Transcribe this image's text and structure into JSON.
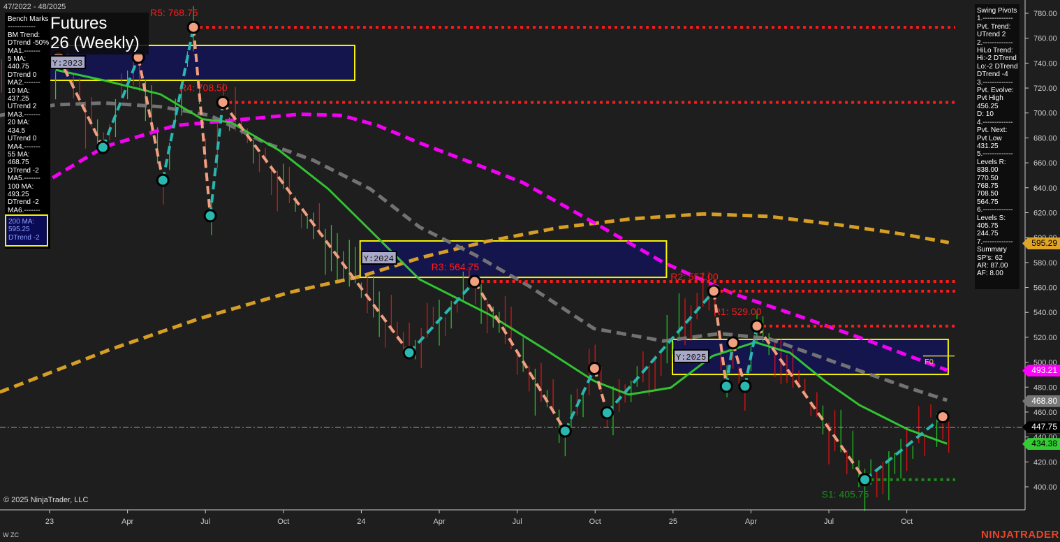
{
  "header": {
    "date_range": "47/2022 - 48/2025",
    "title_line1": "Futures",
    "title_line2": "26 (Weekly)"
  },
  "benchmarks": {
    "lines": [
      "Bench Marks",
      "------------",
      "BM Trend:",
      "DTrend -50%",
      "MA1.-------",
      "5 MA:",
      "440.75",
      "DTrend 0",
      "MA2.-------",
      "10 MA:",
      "437.25",
      "UTrend 2",
      "MA3.-------",
      "20 MA:",
      "434.5",
      "UTrend 0",
      "MA4.-------",
      "55 MA:",
      "468.75",
      "DTrend -2",
      "MA5.-------",
      "100 MA:",
      "493.25",
      "DTrend -2",
      "MA6.-------"
    ],
    "highlight": [
      "200 MA:",
      "595.25",
      "DTrend -2"
    ]
  },
  "swing_pivots": {
    "lines": [
      "Swing Pivots",
      "1.-------------",
      "Pvt. Trend:",
      "UTrend 2",
      "2.-------------",
      "HiLo Trend:",
      "Hi:-2 DTrend",
      "Lo:-2 DTrend",
      "DTrend -4",
      "3.-------------",
      "Pvt. Evolve:",
      "Pvt High",
      "456.25",
      "D: 10",
      "4.-------------",
      "Pvt. Next:",
      "Pvt Low",
      "431.25",
      "5.-------------",
      "Levels R:",
      "838.00",
      "770.50",
      "768.75",
      "708.50",
      "564.75",
      "6.-------------",
      "Levels S:",
      "405.75",
      "244.75",
      "7.-------------",
      "Summary",
      "SP's: 62",
      "AR: 87.00",
      "AF: 8.00"
    ]
  },
  "footer": {
    "copyright": "© 2025 NinjaTrader, LLC",
    "symbol": "W ZC",
    "brand": "NINJATRADER"
  },
  "price_tags": [
    {
      "value": "595.29",
      "price": 595.29,
      "bg": "#e0a526",
      "fg": "#000"
    },
    {
      "value": "493.21",
      "price": 493.21,
      "bg": "#ff00ff",
      "fg": "#fff"
    },
    {
      "value": "468.80",
      "price": 468.8,
      "bg": "#777777",
      "fg": "#fff"
    },
    {
      "value": "447.75",
      "price": 447.75,
      "bg": "#000000",
      "fg": "#fff"
    },
    {
      "value": "434.38",
      "price": 434.38,
      "bg": "#33cc33",
      "fg": "#000"
    }
  ],
  "chart_data": {
    "type": "line",
    "title": "Futures 26 (Weekly)",
    "x_unit": "weeks since first week of 2023",
    "xlim": [
      -8.3,
      162
    ],
    "ylim": [
      390,
      790
    ],
    "y_ticks": [
      400,
      420,
      440,
      460,
      480,
      500,
      520,
      540,
      560,
      580,
      600,
      620,
      640,
      660,
      680,
      700,
      720,
      740,
      760,
      780
    ],
    "x_ticks": [
      {
        "label": "23",
        "w": 0
      },
      {
        "label": "Apr",
        "w": 13
      },
      {
        "label": "Jul",
        "w": 26
      },
      {
        "label": "Oct",
        "w": 39
      },
      {
        "label": "24",
        "w": 52
      },
      {
        "label": "Apr",
        "w": 65
      },
      {
        "label": "Jul",
        "w": 78
      },
      {
        "label": "Oct",
        "w": 91
      },
      {
        "label": "25",
        "w": 104
      },
      {
        "label": "Apr",
        "w": 117
      },
      {
        "label": "Jul",
        "w": 130
      },
      {
        "label": "Oct",
        "w": 143
      }
    ],
    "current_price": 447.75,
    "swing_pivots": [
      {
        "w": 1.5,
        "p": 745,
        "t": "H"
      },
      {
        "w": 8.9,
        "p": 672.4,
        "t": "L"
      },
      {
        "w": 14.8,
        "p": 744.7,
        "t": "H"
      },
      {
        "w": 18.9,
        "p": 646,
        "t": "L"
      },
      {
        "w": 24,
        "p": 768.75,
        "t": "H"
      },
      {
        "w": 26.8,
        "p": 617.5,
        "t": "L"
      },
      {
        "w": 28.9,
        "p": 708.5,
        "t": "H"
      },
      {
        "w": 60,
        "p": 507.6,
        "t": "L"
      },
      {
        "w": 70.9,
        "p": 564.75,
        "t": "H"
      },
      {
        "w": 86,
        "p": 444.8,
        "t": "L"
      },
      {
        "w": 90.9,
        "p": 495,
        "t": "H"
      },
      {
        "w": 93,
        "p": 459.4,
        "t": "L"
      },
      {
        "w": 110.8,
        "p": 557,
        "t": "H"
      },
      {
        "w": 112.9,
        "p": 480.7,
        "t": "L"
      },
      {
        "w": 114,
        "p": 515.5,
        "t": "H"
      },
      {
        "w": 116,
        "p": 480.7,
        "t": "L"
      },
      {
        "w": 118,
        "p": 529,
        "t": "H"
      },
      {
        "w": 136,
        "p": 405.75,
        "t": "L"
      },
      {
        "w": 149,
        "p": 456.25,
        "t": "H"
      }
    ],
    "levels": [
      {
        "label": "R5: 768.75",
        "price": 768.75,
        "from_w": 24,
        "color": "#ff1a1a"
      },
      {
        "label": "R4: 708.50",
        "price": 708.5,
        "from_w": 28.9,
        "color": "#ff1a1a"
      },
      {
        "label": "R3: 564.75",
        "price": 564.75,
        "from_w": 70.9,
        "color": "#ff1a1a"
      },
      {
        "label": "R2: 557.00",
        "price": 557,
        "from_w": 110.8,
        "color": "#ff1a1a"
      },
      {
        "label": "R1: 529.00",
        "price": 529,
        "from_w": 118,
        "color": "#ff1a1a"
      },
      {
        "label": "S1: 405.75",
        "price": 405.75,
        "from_w": 136,
        "color": "#1a8f1a"
      }
    ],
    "year_boxes": [
      {
        "label": "Y:2023",
        "w0": -0.1,
        "w1": 50.9,
        "p_hi": 754.2,
        "p_lo": 726.2
      },
      {
        "label": "Y:2024",
        "w0": 51.8,
        "w1": 102.9,
        "p_hi": 597.3,
        "p_lo": 568.1
      },
      {
        "label": "Y:2025",
        "w0": 103.9,
        "w1": 149.9,
        "p_hi": 518.3,
        "p_lo": 490.2
      }
    ],
    "f0": {
      "label": "F0",
      "price": 505
    },
    "series": [
      {
        "name": "200 MA",
        "color": "#e0a526",
        "dash": true,
        "points": [
          [
            -8.3,
            476
          ],
          [
            10,
            510
          ],
          [
            25,
            535
          ],
          [
            40,
            556
          ],
          [
            52,
            569
          ],
          [
            62,
            584
          ],
          [
            73,
            597
          ],
          [
            85,
            608
          ],
          [
            97,
            615
          ],
          [
            109,
            619
          ],
          [
            120,
            617
          ],
          [
            132,
            610
          ],
          [
            142,
            603
          ],
          [
            150,
            596
          ]
        ]
      },
      {
        "name": "100 MA",
        "color": "#ff00ff",
        "dash": true,
        "points": [
          [
            0.5,
            648
          ],
          [
            9.2,
            673
          ],
          [
            21,
            690
          ],
          [
            32.5,
            695
          ],
          [
            41.8,
            699
          ],
          [
            48.8,
            698
          ],
          [
            54.7,
            690
          ],
          [
            61.7,
            676
          ],
          [
            71,
            659
          ],
          [
            79,
            644
          ],
          [
            90.8,
            612
          ],
          [
            102.4,
            580
          ],
          [
            114,
            555
          ],
          [
            125.6,
            536
          ],
          [
            137.3,
            516
          ],
          [
            149.7,
            493.6
          ]
        ]
      },
      {
        "name": "55 MA",
        "color": "#777777",
        "dash": true,
        "points": [
          [
            -8.3,
            698
          ],
          [
            1,
            706.6
          ],
          [
            9.2,
            708
          ],
          [
            18.5,
            705
          ],
          [
            26.8,
            698
          ],
          [
            36,
            676
          ],
          [
            44,
            662
          ],
          [
            53.5,
            639
          ],
          [
            61.7,
            608.5
          ],
          [
            71,
            586
          ],
          [
            80,
            561
          ],
          [
            90.8,
            527
          ],
          [
            102.4,
            517
          ],
          [
            111.8,
            523
          ],
          [
            119.9,
            519
          ],
          [
            131.6,
            499
          ],
          [
            143.2,
            479.6
          ],
          [
            149.7,
            469.5
          ]
        ]
      },
      {
        "name": "20 MA",
        "color": "#33cc33",
        "dash": false,
        "points": [
          [
            1,
            734.6
          ],
          [
            9.2,
            726
          ],
          [
            18.5,
            715
          ],
          [
            25.5,
            695
          ],
          [
            30.2,
            692.6
          ],
          [
            38.3,
            670
          ],
          [
            46.5,
            639
          ],
          [
            53.5,
            605.7
          ],
          [
            61.7,
            566.5
          ],
          [
            73.3,
            538.4
          ],
          [
            82.6,
            510.4
          ],
          [
            90.8,
            485
          ],
          [
            96.6,
            474
          ],
          [
            103.6,
            479.5
          ],
          [
            110.6,
            505
          ],
          [
            117.7,
            516
          ],
          [
            123.5,
            507.6
          ],
          [
            129.3,
            485
          ],
          [
            135.1,
            465.6
          ],
          [
            143.2,
            446
          ],
          [
            149.7,
            434.6
          ]
        ]
      }
    ]
  }
}
